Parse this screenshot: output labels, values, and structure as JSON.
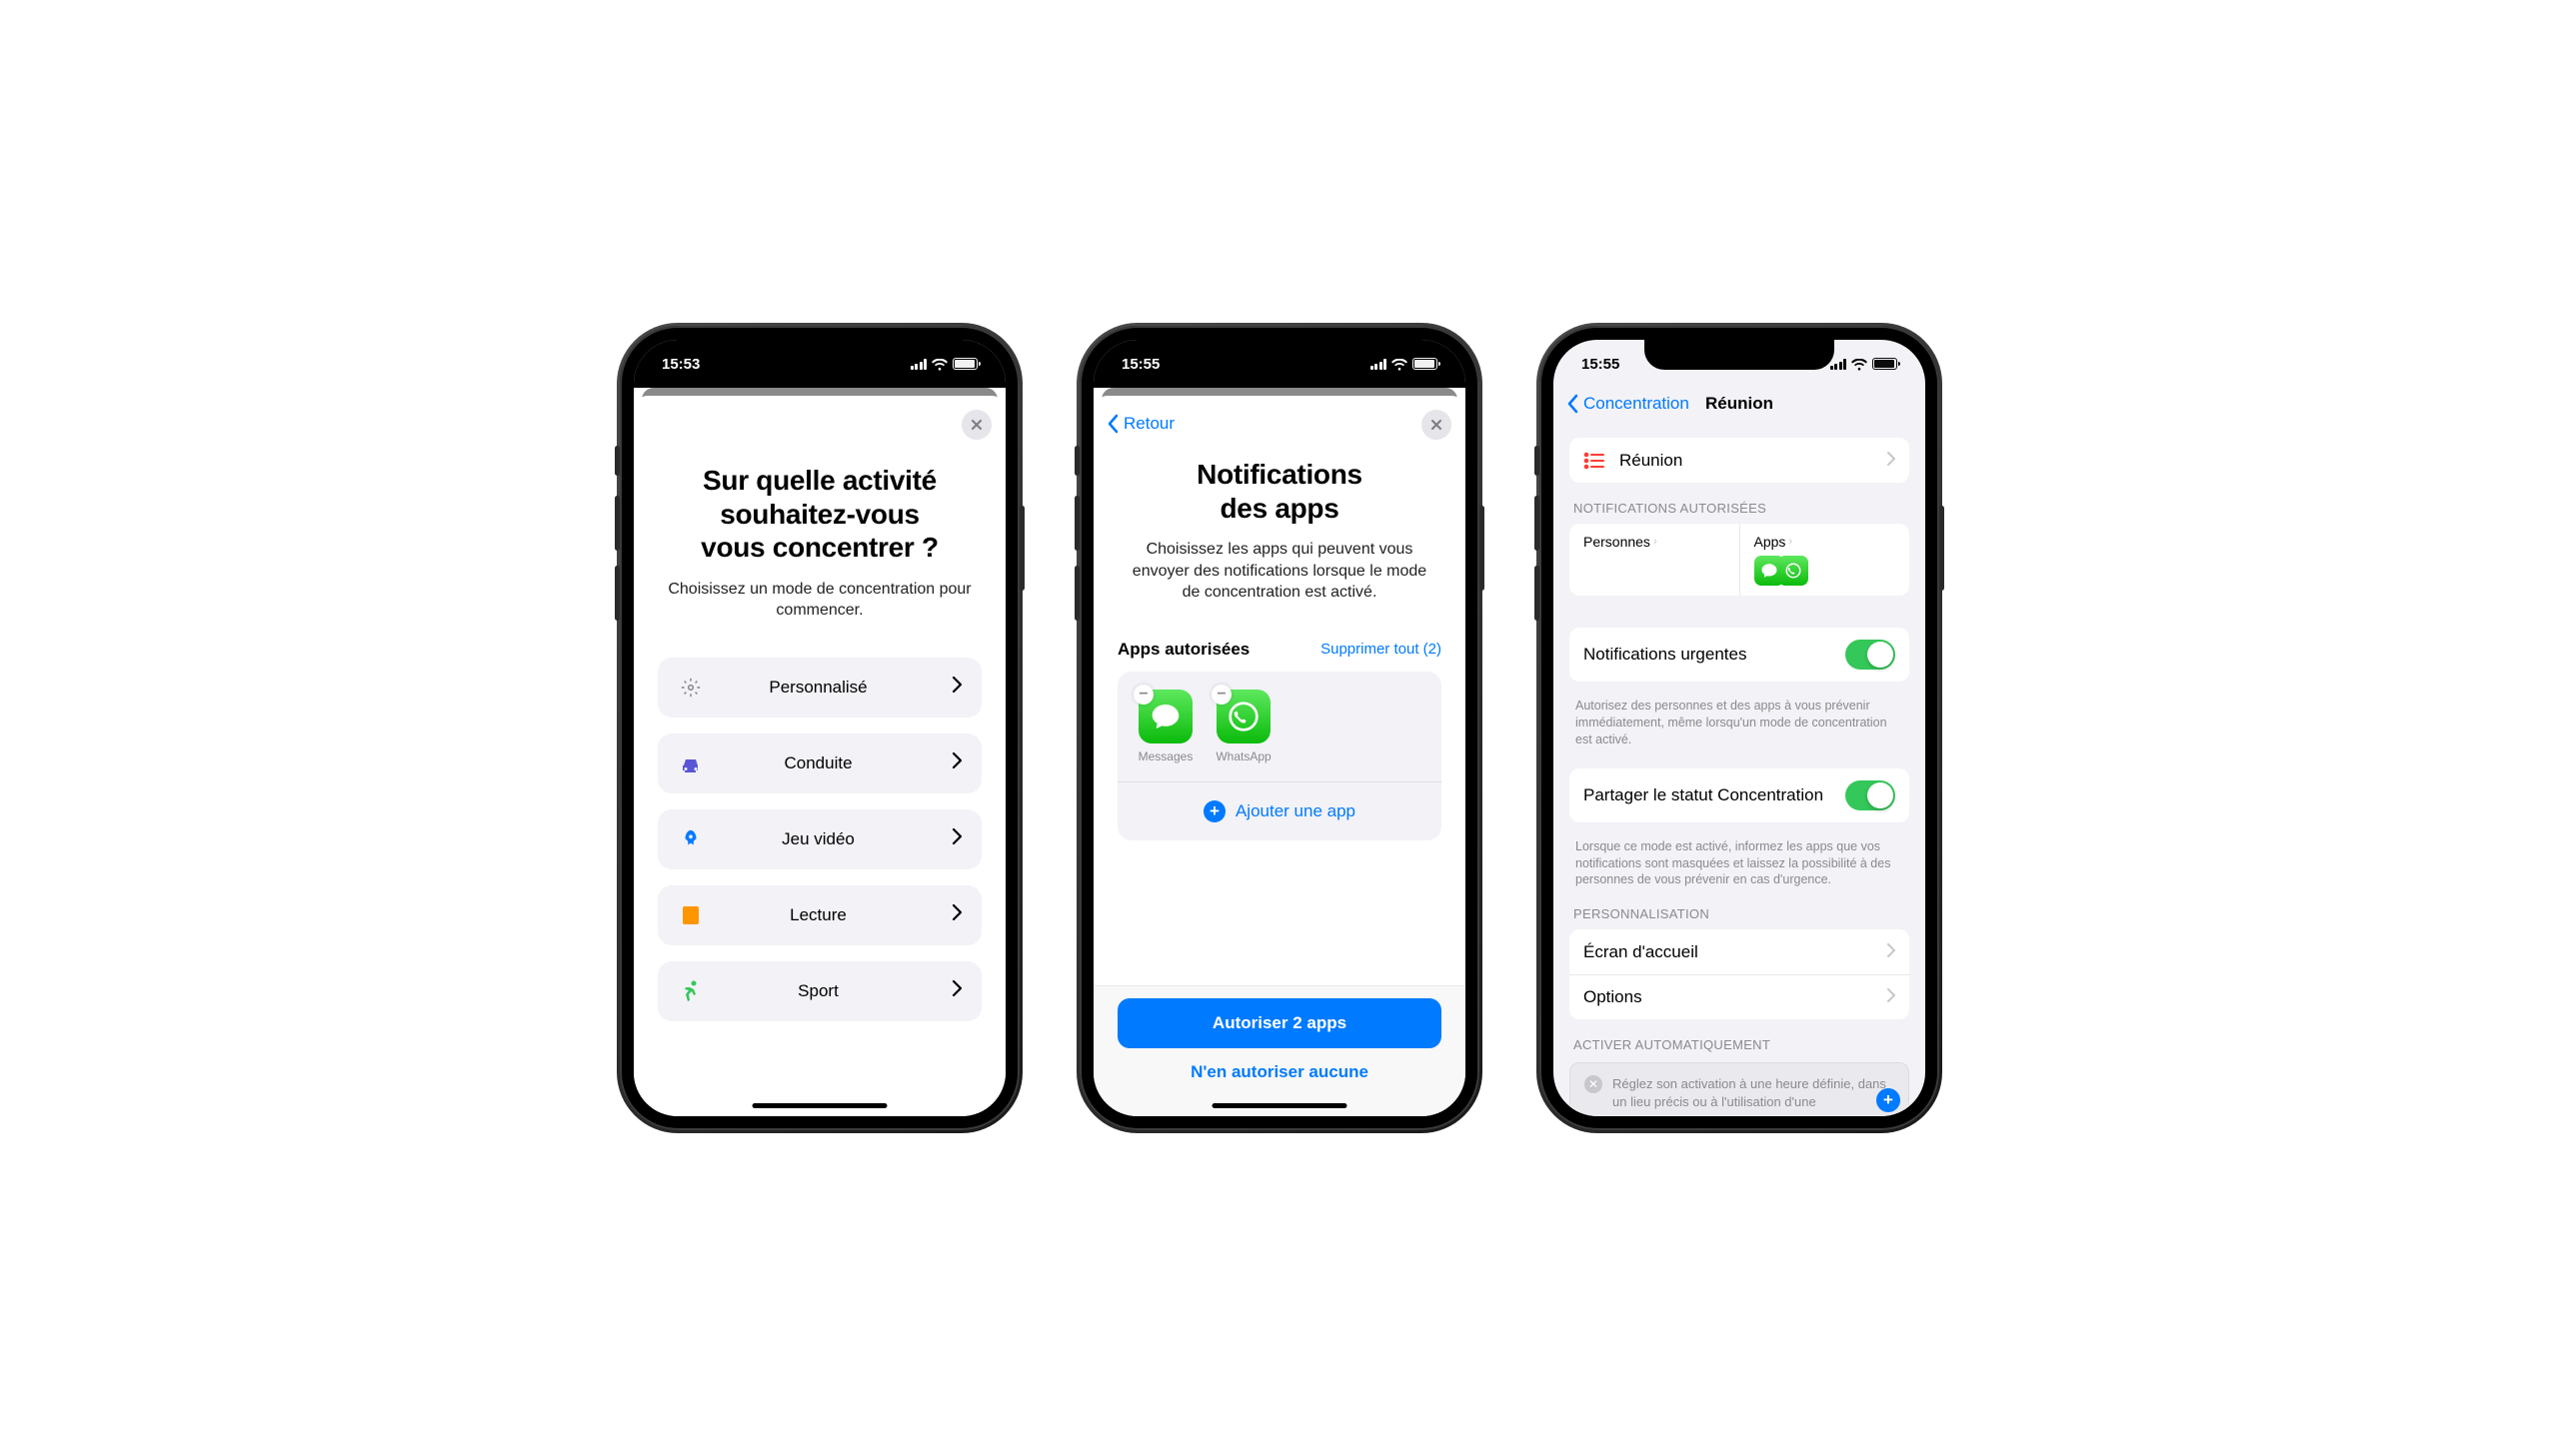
{
  "phone1": {
    "time": "15:53",
    "title_l1": "Sur quelle activité",
    "title_l2": "souhaitez-vous",
    "title_l3": "vous concentrer ?",
    "subtitle": "Choisissez un mode de concentration pour commencer.",
    "options": [
      {
        "label": "Personnalisé",
        "icon": "sparkle",
        "color": "#8e8e93"
      },
      {
        "label": "Conduite",
        "icon": "car",
        "color": "#5856d6"
      },
      {
        "label": "Jeu vidéo",
        "icon": "rocket",
        "color": "#007aff"
      },
      {
        "label": "Lecture",
        "icon": "book",
        "color": "#ff9500"
      },
      {
        "label": "Sport",
        "icon": "runner",
        "color": "#34c759"
      }
    ]
  },
  "phone2": {
    "time": "15:55",
    "back": "Retour",
    "title_l1": "Notifications",
    "title_l2": "des apps",
    "subtitle": "Choisissez les apps qui peuvent vous envoyer des notifications lorsque le mode de concentration est activé.",
    "section_title": "Apps autorisées",
    "delete_all": "Supprimer tout (2)",
    "apps": [
      {
        "name": "Messages",
        "type": "messages"
      },
      {
        "name": "WhatsApp",
        "type": "whatsapp"
      }
    ],
    "add_app": "Ajouter une app",
    "primary_btn": "Autoriser 2 apps",
    "secondary_btn": "N'en autoriser aucune"
  },
  "phone3": {
    "time": "15:55",
    "back": "Concentration",
    "title": "Réunion",
    "focus_name": "Réunion",
    "section_allowed": "NOTIFICATIONS AUTORISÉES",
    "people_label": "Personnes",
    "apps_label": "Apps",
    "urgent": {
      "label": "Notifications urgentes",
      "on": true
    },
    "urgent_footer": "Autorisez des personnes et des apps à vous prévenir immédiatement, même lorsqu'un mode de concentration est activé.",
    "share": {
      "label": "Partager le statut Concentration",
      "on": true
    },
    "share_footer": "Lorsque ce mode est activé, informez les apps que vos notifications sont masquées et laissez la possibilité à des personnes de vous prévenir en cas d'urgence.",
    "section_custom": "PERSONNALISATION",
    "home_screen": "Écran d'accueil",
    "options": "Options",
    "section_auto": "ACTIVER AUTOMATIQUEMENT",
    "auto_hint": "Réglez son activation à une heure définie, dans un lieu précis ou à l'utilisation d'une"
  }
}
